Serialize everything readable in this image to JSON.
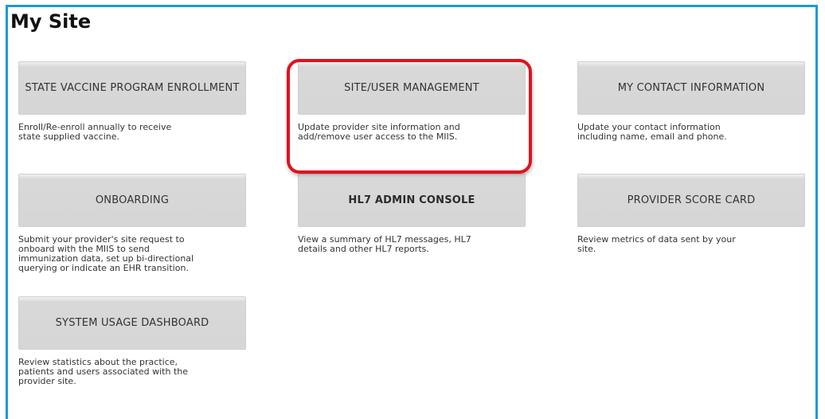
{
  "page": {
    "title": "My Site"
  },
  "colors": {
    "frame": "#1a9ad6",
    "highlight": "#e0111d",
    "tile": "#d6d6d6"
  },
  "tiles": [
    {
      "label": "STATE VACCINE PROGRAM ENROLLMENT",
      "desc": "Enroll/Re-enroll annually to receive\nstate supplied vaccine."
    },
    {
      "label": "SITE/USER MANAGEMENT",
      "desc": "Update provider site information and\nadd/remove user access to the MIIS."
    },
    {
      "label": "MY CONTACT INFORMATION",
      "desc": "Update your contact information\nincluding name, email and phone."
    },
    {
      "label": "ONBOARDING",
      "desc": "Submit your provider's site request to\nonboard with the MIIS to send\nimmunization data, set up bi-directional\nquerying or indicate an EHR transition."
    },
    {
      "label": "HL7 ADMIN CONSOLE",
      "desc": "View a summary of HL7 messages, HL7\ndetails and other HL7 reports."
    },
    {
      "label": "PROVIDER SCORE CARD",
      "desc": "Review metrics of data sent by your\nsite."
    },
    {
      "label": "SYSTEM USAGE DASHBOARD",
      "desc": "Review statistics about the practice,\npatients and users associated with the\nprovider site."
    }
  ]
}
